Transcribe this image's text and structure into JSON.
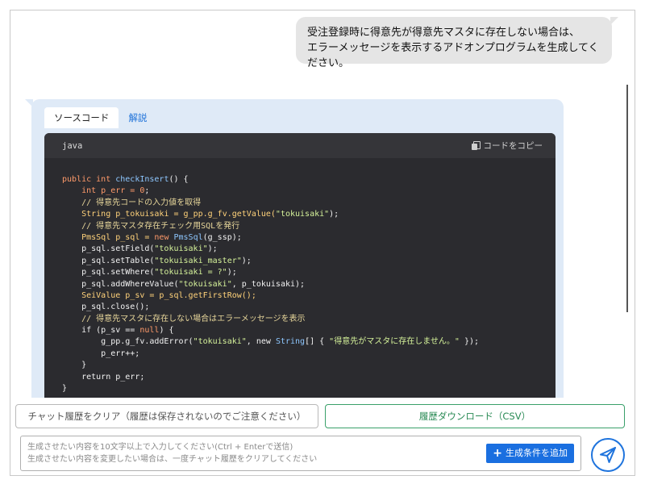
{
  "user_message": {
    "line1": "受注登録時に得意先が得意先マスタに存在しない場合は、",
    "line2": "エラーメッセージを表示するアドオンプログラムを生成してください。"
  },
  "response": {
    "tabs": [
      "ソースコード",
      "解説"
    ],
    "code_language": "java",
    "copy_label": "コードをコピー",
    "code": {
      "l1": [
        "public",
        " ",
        "int",
        " ",
        "checkInsert",
        "() {"
      ],
      "l2": [
        "    ",
        "int",
        " p_err = ",
        "0",
        ";"
      ],
      "l3": "    // 得意先コードの入力値を取得",
      "l4": [
        "    ",
        "String",
        " p_tokuisaki = g_pp.g_fv.getValue(",
        "\"tokuisaki\"",
        ");"
      ],
      "l5": "    // 得意先マスタ存在チェック用SQLを発行",
      "l6": [
        "    ",
        "PmsSql",
        " p_sql = ",
        "new",
        " ",
        "PmsSql",
        "(g_ssp);"
      ],
      "l7": [
        "    p_sql.setField(",
        "\"tokuisaki\"",
        ");"
      ],
      "l8": [
        "    p_sql.setTable(",
        "\"tokuisaki_master\"",
        ");"
      ],
      "l9": [
        "    p_sql.setWhere(",
        "\"tokuisaki = ?\"",
        ");"
      ],
      "l10": [
        "    p_sql.addWhereValue(",
        "\"tokuisaki\"",
        ", p_tokuisaki);"
      ],
      "l11": [
        "    ",
        "SeiValue",
        " p_sv = p_sql.getFirstRow();"
      ],
      "l12": "    p_sql.close();",
      "l13": "    // 得意先マスタに存在しない場合はエラーメッセージを表示",
      "l14": [
        "    ",
        "if",
        " (p_sv == ",
        "null",
        ") {"
      ],
      "l15": [
        "        g_pp.g_fv.addError(",
        "\"tokuisaki\"",
        ", ",
        "new",
        " ",
        "String",
        "[] { ",
        "\"得意先がマスタに存在しません。\"",
        " });"
      ],
      "l16": "        p_err++;",
      "l17": "    }",
      "l18": [
        "    ",
        "return",
        " p_err;"
      ],
      "l19": "}"
    }
  },
  "actions": {
    "clear_history": "チャット履歴をクリア（履歴は保存されないのでご注意ください）",
    "download_history": "履歴ダウンロード（CSV）"
  },
  "input": {
    "placeholder_line1": "生成させたい内容を10文字以上で入力してください(Ctrl + Enterで送信)",
    "placeholder_line2": "生成させたい内容を変更したい場合は、一度チャット履歴をクリアしてください",
    "add_condition_label": "生成条件を追加"
  },
  "icons": {
    "copy": "copy-icon",
    "plus": "plus-icon",
    "send": "send-icon"
  },
  "colors": {
    "accent": "#1a6fe0",
    "download_green": "#2a8a55",
    "code_bg": "#2b2b2f",
    "bot_card_bg": "#dfeaf7",
    "user_bubble_bg": "#e5e5e5"
  }
}
